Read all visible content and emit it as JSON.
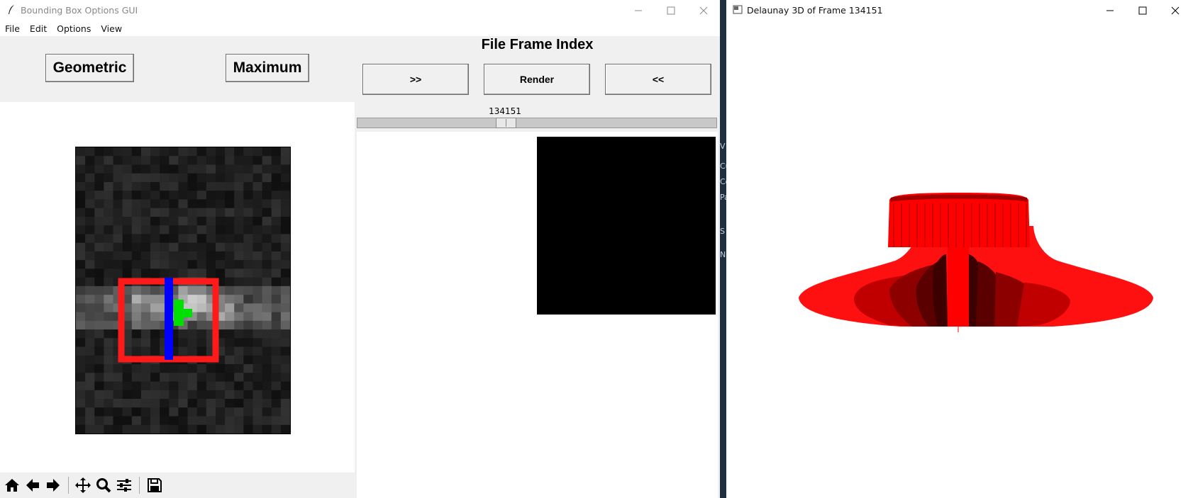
{
  "left_window": {
    "title": "Bounding Box Options GUI",
    "menu": [
      "File",
      "Edit",
      "Options",
      "View"
    ],
    "buttons": {
      "geometric": "Geometric",
      "maximum": "Maximum"
    },
    "frame_heading": "File Frame Index",
    "nav": {
      "next": ">>",
      "render": "Render",
      "prev": "<<"
    },
    "slider": {
      "value": "134151",
      "position_fraction": 0.41
    },
    "toolbar_icons": [
      "home-icon",
      "back-arrow-icon",
      "forward-arrow-icon",
      "pan-move-icon",
      "zoom-icon",
      "configure-subplots-icon",
      "save-icon"
    ]
  },
  "right_window": {
    "title": "Delaunay 3D of Frame 134151"
  },
  "colors": {
    "bbox_red": "#ff1a1a",
    "axis_blue": "#0000ff",
    "marker_green": "#00e000",
    "mesh_red": "#ff0000",
    "mesh_dark": "#6e0000"
  },
  "background_strip_text": [
    "V",
    "Cu",
    "Co",
    "Pa",
    "S",
    "Na"
  ]
}
